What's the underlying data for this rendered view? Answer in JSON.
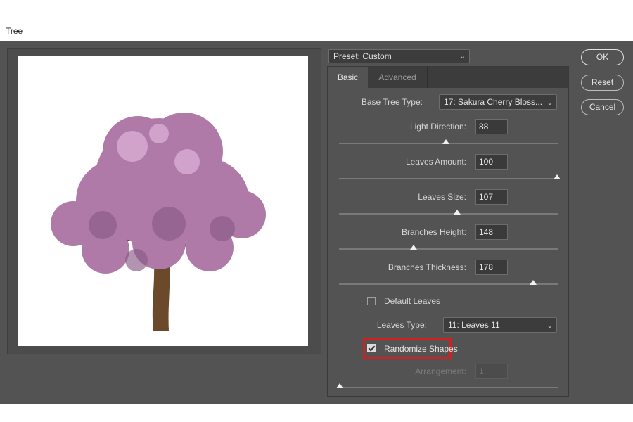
{
  "window": {
    "title": "Tree"
  },
  "preset": {
    "label": "Preset:",
    "value": "Custom"
  },
  "tabs": [
    {
      "label": "Basic",
      "active": true
    },
    {
      "label": "Advanced",
      "active": false
    }
  ],
  "buttons": {
    "ok": "OK",
    "reset": "Reset",
    "cancel": "Cancel"
  },
  "base_tree_type": {
    "label": "Base Tree Type:",
    "value": "17: Sakura Cherry Bloss..."
  },
  "sliders": {
    "light_direction": {
      "label": "Light Direction:",
      "value": "88",
      "fraction": 0.49
    },
    "leaves_amount": {
      "label": "Leaves Amount:",
      "value": "100",
      "fraction": 1.0
    },
    "leaves_size": {
      "label": "Leaves Size:",
      "value": "107",
      "fraction": 0.54
    },
    "branches_height": {
      "label": "Branches Height:",
      "value": "148",
      "fraction": 0.34
    },
    "branches_thickness": {
      "label": "Branches Thickness:",
      "value": "178",
      "fraction": 0.89
    },
    "arrangement": {
      "label": "Arrangement:",
      "value": "1",
      "fraction": 0.0,
      "disabled": true
    }
  },
  "default_leaves": {
    "label": "Default Leaves",
    "checked": false
  },
  "leaves_type": {
    "label": "Leaves Type:",
    "value": "11: Leaves 11"
  },
  "randomize_shapes": {
    "label": "Randomize Shapes",
    "checked": true,
    "highlighted": true
  },
  "colors": {
    "dialog_bg": "#535353",
    "highlight": "#d21f1f",
    "foliage": "#b07aa8",
    "trunk": "#6b4a2b"
  },
  "icons": [
    "chevron-down-icon",
    "slider-thumb-icon",
    "checkbox-checked-icon"
  ]
}
